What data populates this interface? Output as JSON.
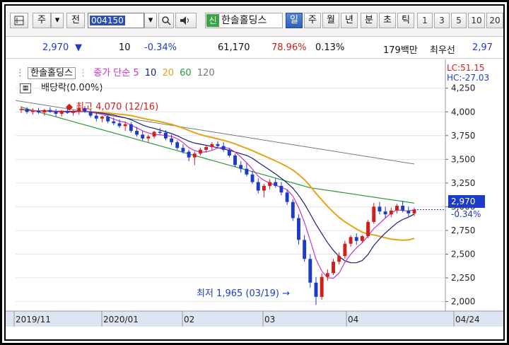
{
  "toolbar": {
    "market": "주",
    "prev": "전",
    "code": "004150",
    "category_badge": "신",
    "name": "한솔홀딩스",
    "periods": [
      {
        "label": "일",
        "active": true
      },
      {
        "label": "주",
        "active": false
      },
      {
        "label": "월",
        "active": false
      },
      {
        "label": "년",
        "active": false
      },
      {
        "label": "분",
        "active": false
      },
      {
        "label": "초",
        "active": false
      },
      {
        "label": "틱",
        "active": false
      }
    ],
    "intervals": [
      "1",
      "3",
      "5",
      "10",
      "20"
    ]
  },
  "status": {
    "price": "2,970",
    "change": "10",
    "change_pct": "-0.34%",
    "volume": "61,170",
    "volume_ratio": "78.96%",
    "turnover": "0.13%",
    "amount": "179백만",
    "broker": "최우선",
    "right_price": "2,97"
  },
  "legend": {
    "stock": "한솔홀딩스",
    "ma_label": "종가 단순",
    "ma_periods": [
      "5",
      "10",
      "20",
      "60",
      "120"
    ],
    "lc": "LC:51.15",
    "hc": "HC:-27.03",
    "dividend": "배당락(0.00%)"
  },
  "annotations": {
    "high": "최고 4,070 (12/16)",
    "low": "최저 1,965 (03/19)"
  },
  "price_tag": {
    "price": "2,970",
    "pct": "-0.34%"
  },
  "colors": {
    "up": "#d21d1d",
    "down": "#1c3cc8",
    "ma5": "#cc33cc",
    "ma10": "#1a1a7a",
    "ma20": "#e8a317",
    "ma60": "#2a9a3a",
    "ma120": "#777777",
    "accent": "#2f5fbf"
  },
  "chart_data": {
    "type": "candlestick",
    "title": "한솔홀딩스",
    "y_ticks": [
      2000,
      2250,
      2500,
      2750,
      3000,
      3250,
      3500,
      3750,
      4000,
      4250
    ],
    "x_labels": [
      "2019/11",
      "2020/01",
      "02",
      "03",
      "04",
      "04/24"
    ],
    "ohlc": [
      [
        4020,
        4060,
        3990,
        4030
      ],
      [
        4030,
        4050,
        3980,
        4000
      ],
      [
        4000,
        4040,
        3970,
        4010
      ],
      [
        4010,
        4040,
        3980,
        3995
      ],
      [
        3995,
        4030,
        3960,
        4020
      ],
      [
        4020,
        4050,
        3990,
        4000
      ],
      [
        4000,
        4030,
        3950,
        3980
      ],
      [
        3980,
        4020,
        3950,
        4010
      ],
      [
        4010,
        4040,
        3980,
        3990
      ],
      [
        3990,
        4020,
        3960,
        4000
      ],
      [
        4000,
        4070,
        3970,
        4040
      ],
      [
        4040,
        4060,
        3990,
        4000
      ],
      [
        4000,
        4030,
        3940,
        3960
      ],
      [
        3960,
        3990,
        3900,
        3930
      ],
      [
        3930,
        3960,
        3890,
        3950
      ],
      [
        3950,
        3970,
        3880,
        3900
      ],
      [
        3900,
        3940,
        3860,
        3880
      ],
      [
        3880,
        3920,
        3830,
        3850
      ],
      [
        3850,
        3900,
        3800,
        3870
      ],
      [
        3870,
        3890,
        3780,
        3800
      ],
      [
        3800,
        3840,
        3740,
        3760
      ],
      [
        3760,
        3800,
        3700,
        3720
      ],
      [
        3720,
        3760,
        3680,
        3740
      ],
      [
        3740,
        3800,
        3720,
        3790
      ],
      [
        3790,
        3830,
        3760,
        3780
      ],
      [
        3780,
        3810,
        3700,
        3720
      ],
      [
        3720,
        3760,
        3650,
        3680
      ],
      [
        3680,
        3700,
        3600,
        3620
      ],
      [
        3620,
        3660,
        3560,
        3580
      ],
      [
        3580,
        3600,
        3480,
        3520
      ],
      [
        3520,
        3580,
        3440,
        3560
      ],
      [
        3560,
        3620,
        3540,
        3600
      ],
      [
        3600,
        3650,
        3570,
        3630
      ],
      [
        3630,
        3680,
        3600,
        3660
      ],
      [
        3660,
        3690,
        3620,
        3640
      ],
      [
        3640,
        3680,
        3580,
        3600
      ],
      [
        3600,
        3620,
        3520,
        3540
      ],
      [
        3540,
        3560,
        3420,
        3440
      ],
      [
        3440,
        3480,
        3360,
        3400
      ],
      [
        3400,
        3460,
        3320,
        3340
      ],
      [
        3340,
        3380,
        3240,
        3260
      ],
      [
        3260,
        3300,
        3140,
        3170
      ],
      [
        3170,
        3240,
        3100,
        3220
      ],
      [
        3220,
        3290,
        3180,
        3260
      ],
      [
        3260,
        3300,
        3200,
        3220
      ],
      [
        3220,
        3260,
        3120,
        3150
      ],
      [
        3150,
        3180,
        3020,
        3050
      ],
      [
        3050,
        3080,
        2850,
        2880
      ],
      [
        2880,
        2920,
        2600,
        2650
      ],
      [
        2650,
        2700,
        2420,
        2450
      ],
      [
        2450,
        2500,
        2150,
        2200
      ],
      [
        2200,
        2260,
        1965,
        2050
      ],
      [
        2050,
        2300,
        2020,
        2260
      ],
      [
        2260,
        2340,
        2220,
        2300
      ],
      [
        2300,
        2450,
        2280,
        2420
      ],
      [
        2420,
        2520,
        2390,
        2480
      ],
      [
        2480,
        2640,
        2450,
        2610
      ],
      [
        2610,
        2700,
        2580,
        2680
      ],
      [
        2680,
        2720,
        2600,
        2640
      ],
      [
        2640,
        2700,
        2620,
        2690
      ],
      [
        2690,
        2860,
        2670,
        2840
      ],
      [
        2840,
        3040,
        2820,
        3000
      ],
      [
        3000,
        3050,
        2920,
        2950
      ],
      [
        2950,
        3000,
        2880,
        2920
      ],
      [
        2920,
        2990,
        2890,
        2960
      ],
      [
        2960,
        3030,
        2930,
        3010
      ],
      [
        3010,
        3060,
        2940,
        2960
      ],
      [
        2960,
        3000,
        2900,
        2930
      ],
      [
        2930,
        2990,
        2900,
        2970
      ]
    ],
    "ma120": [
      4120,
      3450
    ]
  }
}
